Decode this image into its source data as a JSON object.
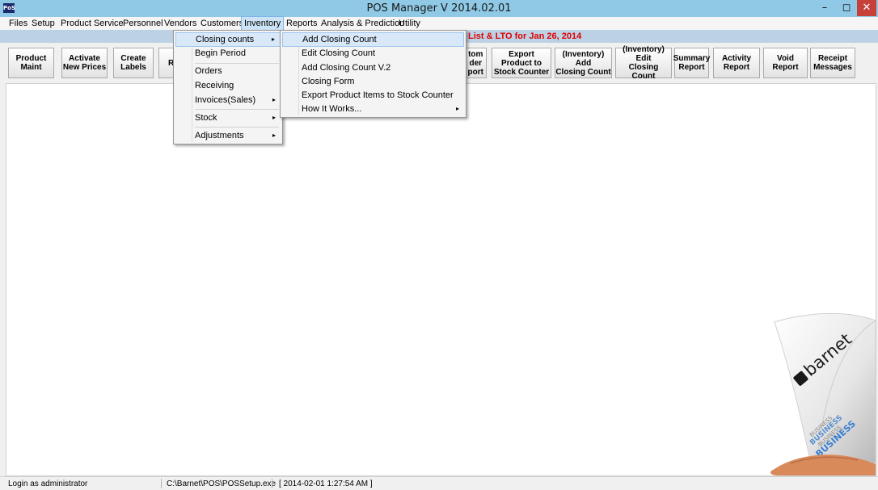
{
  "window": {
    "app_icon_text": "PoS",
    "title": "POS Manager V 2014.02.01",
    "min_glyph": "–",
    "max_glyph": "◻",
    "close_glyph": "✕"
  },
  "menubar": {
    "items": [
      "Files",
      "Setup",
      "Product Service",
      "Personnel",
      "Vendors",
      "Customers",
      "Inventory",
      "Reports",
      "Analysis & Prediction",
      "Utility"
    ]
  },
  "notice": "List & LTO for  Jan 26, 2014",
  "toolbar": {
    "buttons": [
      "Product\nMaint",
      "Activate\nNew Prices",
      "Create\nLabels",
      "R",
      "tom\nder\nport",
      "Export\nProduct to\nStock Counter",
      "(Inventory)\nAdd\nClosing Count",
      "(Inventory)\nEdit\nClosing Count",
      "Summary\nReport",
      "Activity\nReport",
      "Void\nReport",
      "Receipt\nMessages"
    ]
  },
  "inventory_menu": {
    "items": [
      {
        "label": "Closing  counts",
        "arrow": "▸"
      },
      {
        "label": "Begin Period",
        "arrow": ""
      },
      {
        "label": "Orders",
        "arrow": ""
      },
      {
        "label": "Receiving",
        "arrow": ""
      },
      {
        "label": "Invoices(Sales)",
        "arrow": "▸"
      },
      {
        "label": "Stock",
        "arrow": "▸"
      },
      {
        "label": "Adjustments",
        "arrow": "▸"
      }
    ]
  },
  "closing_counts_menu": {
    "items": [
      {
        "label": "Add Closing Count",
        "arrow": ""
      },
      {
        "label": "Edit Closing Count",
        "arrow": ""
      },
      {
        "label": "Add Closing Count  V.2",
        "arrow": ""
      },
      {
        "label": "Closing Form",
        "arrow": ""
      },
      {
        "label": "Export Product Items to Stock Counter",
        "arrow": ""
      },
      {
        "label": "How It Works...",
        "arrow": "▸"
      }
    ]
  },
  "statusbar": {
    "login": "Login as administrator",
    "path": "C:\\Barnet\\POS\\POSSetup.exe",
    "timestamp": "[  2014-02-01 1:27:54 AM  ]"
  },
  "logo": {
    "brand": "barnet",
    "text": "BUSINESS"
  },
  "colors": {
    "titlebar": "#8fc9e6",
    "notice": "#e00000",
    "close_button": "#c7413b",
    "menu_highlight": "#d8e8f8"
  }
}
